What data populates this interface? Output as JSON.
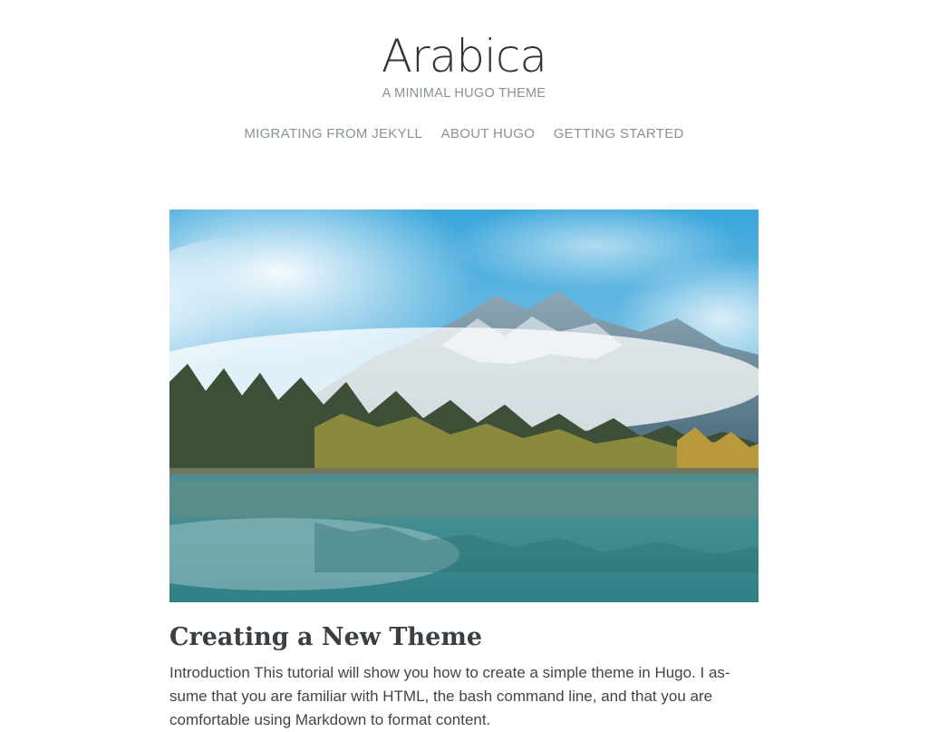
{
  "site": {
    "title": "Arabica",
    "subtitle": "A MINIMAL HUGO THEME"
  },
  "nav": {
    "items": [
      {
        "label": "MIGRATING FROM JEKYLL"
      },
      {
        "label": "ABOUT HUGO"
      },
      {
        "label": "GETTING STARTED"
      }
    ]
  },
  "post": {
    "title": "Creating a New Theme",
    "excerpt": "Introduction This tutorial will show you how to create a simple theme in Hugo. I as-sume that you are familiar with HTML, the bash command line, and that you are comfortable using Markdown to format content."
  },
  "colors": {
    "title": "#2f3437",
    "muted": "#8a9199",
    "text": "#3f454b"
  }
}
